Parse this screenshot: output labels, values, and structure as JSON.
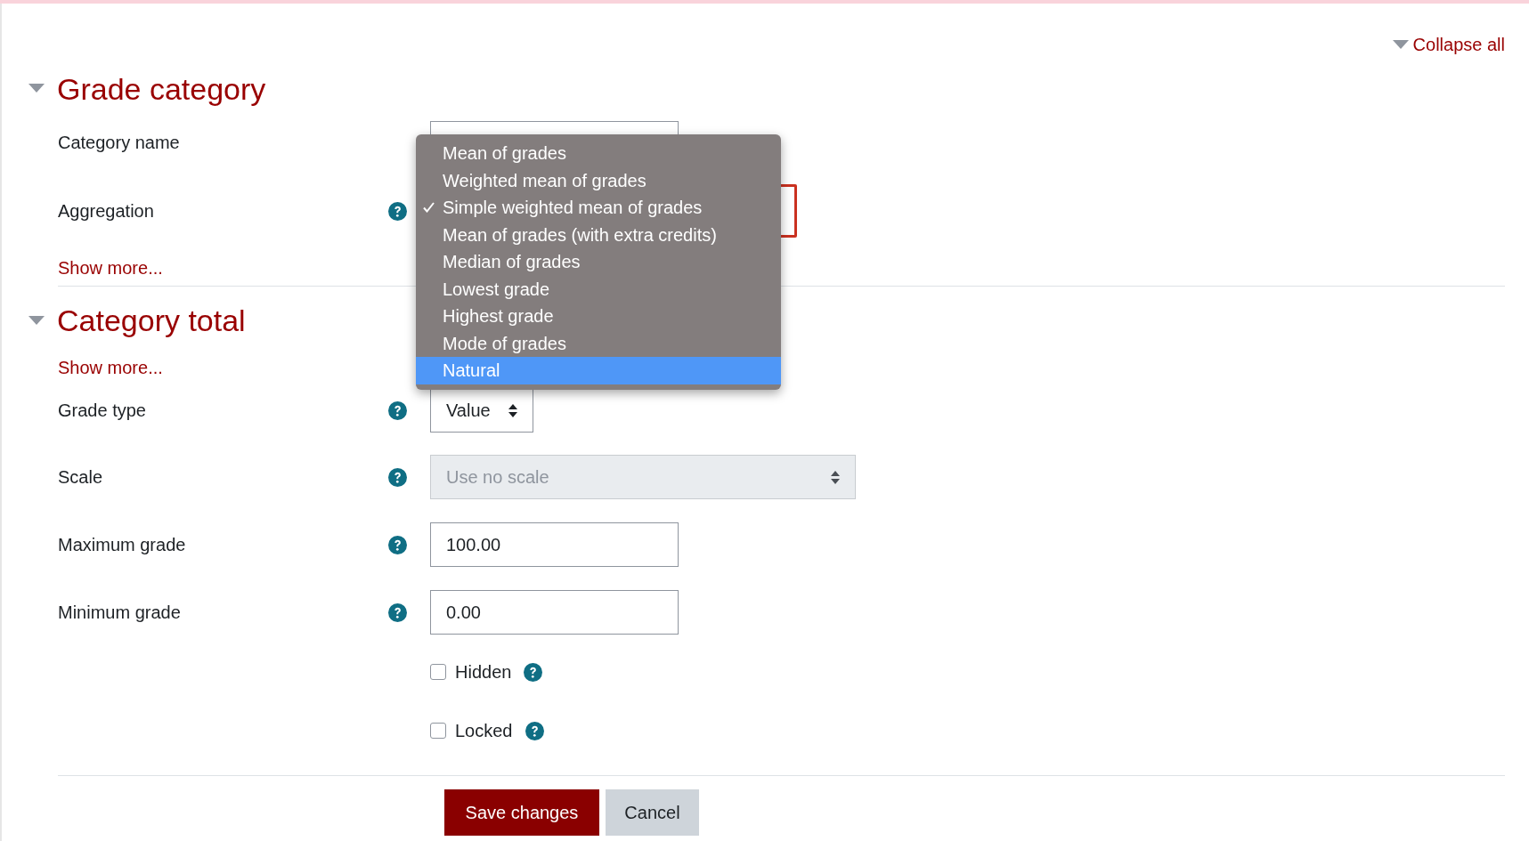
{
  "collapse_all": "Collapse all",
  "sections": [
    {
      "title": "Grade category",
      "expanded": true
    },
    {
      "title": "Category total",
      "expanded": true
    }
  ],
  "grade_category": {
    "category_name": {
      "label": "Category name"
    },
    "aggregation": {
      "label": "Aggregation"
    },
    "show_more": "Show more..."
  },
  "category_total": {
    "show_more": "Show more...",
    "fields": [
      {
        "kind": "select",
        "label": "Grade type",
        "value": "Value",
        "disabled": false
      },
      {
        "kind": "select",
        "label": "Scale",
        "value": "Use no scale",
        "disabled": true
      },
      {
        "kind": "text",
        "label": "Maximum grade",
        "value": "100.00"
      },
      {
        "kind": "text",
        "label": "Minimum grade",
        "value": "0.00"
      },
      {
        "kind": "checkbox",
        "label": "Hidden",
        "checked": false
      },
      {
        "kind": "checkbox",
        "label": "Locked",
        "checked": false
      }
    ]
  },
  "aggregation_menu": [
    {
      "label": "Mean of grades",
      "selected": false,
      "highlighted": false
    },
    {
      "label": "Weighted mean of grades",
      "selected": false,
      "highlighted": false
    },
    {
      "label": "Simple weighted mean of grades",
      "selected": true,
      "highlighted": false
    },
    {
      "label": "Mean of grades (with extra credits)",
      "selected": false,
      "highlighted": false
    },
    {
      "label": "Median of grades",
      "selected": false,
      "highlighted": false
    },
    {
      "label": "Lowest grade",
      "selected": false,
      "highlighted": false
    },
    {
      "label": "Highest grade",
      "selected": false,
      "highlighted": false
    },
    {
      "label": "Mode of grades",
      "selected": false,
      "highlighted": false
    },
    {
      "label": "Natural",
      "selected": false,
      "highlighted": true
    }
  ],
  "buttons": [
    {
      "kind": "primary",
      "label": "Save changes"
    },
    {
      "kind": "secondary",
      "label": "Cancel"
    }
  ]
}
